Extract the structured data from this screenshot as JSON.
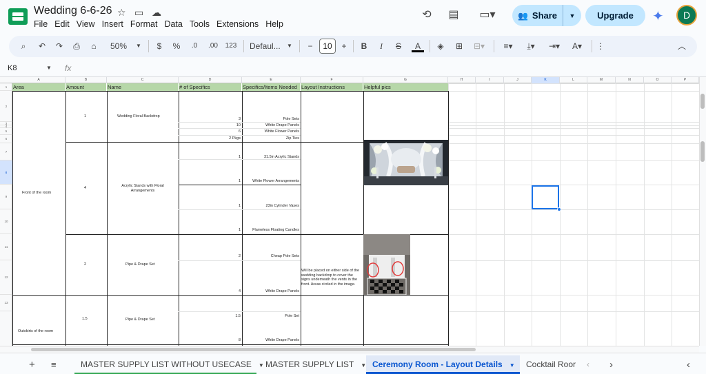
{
  "doc": {
    "title": "Wedding 6-6-26"
  },
  "menu": [
    "File",
    "Edit",
    "View",
    "Insert",
    "Format",
    "Data",
    "Tools",
    "Extensions",
    "Help"
  ],
  "header_buttons": {
    "share": "Share",
    "upgrade": "Upgrade",
    "avatar_letter": "D"
  },
  "toolbar": {
    "zoom": "50%",
    "currency": "$",
    "percent": "%",
    "dec_decrease": ".0",
    "dec_increase": ".00",
    "format_123": "123",
    "font": "Defaul...",
    "font_size": "10",
    "bold": "B",
    "italic": "I",
    "strike": "S",
    "text_color": "A"
  },
  "formula_bar": {
    "name_box": "K8",
    "fx": "fx",
    "content": ""
  },
  "columns": [
    "A",
    "B",
    "C",
    "D",
    "E",
    "F",
    "G",
    "H",
    "I",
    "J",
    "K",
    "L",
    "M",
    "N",
    "O",
    "P"
  ],
  "rows": [
    "1",
    "2",
    "3",
    "4",
    "5",
    "6",
    "7",
    "8",
    "9",
    "10",
    "11",
    "12",
    "13"
  ],
  "header_row": [
    "Area",
    "Amount",
    "Name",
    "# of Specifics",
    "Specifics/Items Needed",
    "Layout Instructions",
    "Helpful pics"
  ],
  "cells": {
    "area_front": "Front of the room",
    "area_outskirts": "Outskirts of the room",
    "amt_1": "1",
    "amt_4": "4",
    "amt_2": "2",
    "amt_15": "1.5",
    "name_backdrop": "Wedding Floral Backdrop",
    "name_acrylic": "Acrylic Stands with Floral Arrangements",
    "name_pipe1": "Pipe & Drape Set",
    "name_pipe2": "Pipe & Drape Set",
    "spec_num": [
      "3",
      "10",
      "6",
      "2 Pkgs",
      "1",
      "1",
      "1",
      "1",
      "2",
      "4",
      "1.5",
      "8"
    ],
    "spec_items": [
      "Pole Sets",
      "White Drape Panels",
      "White Flower Panels",
      "Zip Ties",
      "31.5in Acrylic Stands",
      "White Flower Arrangements",
      "23in Cylinder Vases",
      "Flameless Floating Candles",
      "Cheap Pole Sets",
      "White Drape Panels",
      "Pole Set",
      "White Drape Panels"
    ],
    "layout_note": "Will be placed on either side of the wedding backdrop to cover the signs underneath the vents in the front. Areas circled in the image."
  },
  "sheets": [
    {
      "label": "MASTER SUPPLY LIST WITHOUT USECASE",
      "active": false
    },
    {
      "label": "MASTER SUPPLY LIST",
      "active": false
    },
    {
      "label": "Ceremony Room - Layout Details",
      "active": true
    },
    {
      "label": "Cocktail Roor",
      "active": false
    }
  ],
  "colors": {
    "header_green": "#b6d7a8",
    "accent": "#0b57d0",
    "share_bg": "#c2e7ff"
  }
}
